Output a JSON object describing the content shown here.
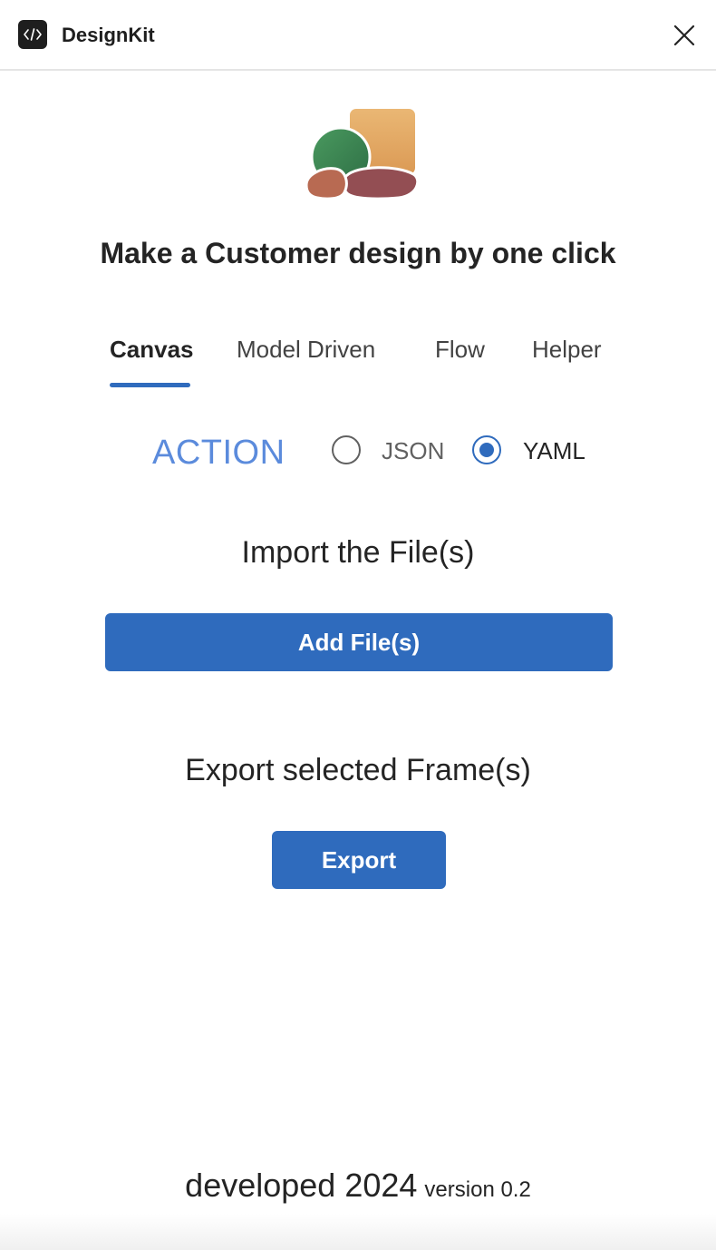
{
  "app": {
    "title": "DesignKit",
    "icon": "code-brackets-icon"
  },
  "hero": {
    "headline": "Make a Customer design by one click",
    "colors": {
      "square": "#e0a35e",
      "circle": "#3d8a52",
      "left_pebble": "#b86a52",
      "right_pebble": "#934e53"
    }
  },
  "tabs": [
    {
      "label": "Canvas",
      "active": true
    },
    {
      "label": "Model Driven",
      "active": false
    },
    {
      "label": "Flow",
      "active": false
    },
    {
      "label": "Helper",
      "active": false
    }
  ],
  "action": {
    "label": "ACTION",
    "options": [
      {
        "label": "JSON",
        "selected": false
      },
      {
        "label": "YAML",
        "selected": true
      }
    ]
  },
  "import": {
    "title": "Import the File(s)",
    "button_label": "Add File(s)"
  },
  "export": {
    "title": "Export selected Frame(s)",
    "button_label": "Export"
  },
  "footer": {
    "developed": "developed 2024",
    "version": "version 0.2"
  },
  "colors": {
    "accent": "#2f6bbd",
    "action_label": "#5b8bdc",
    "text": "#242424"
  }
}
